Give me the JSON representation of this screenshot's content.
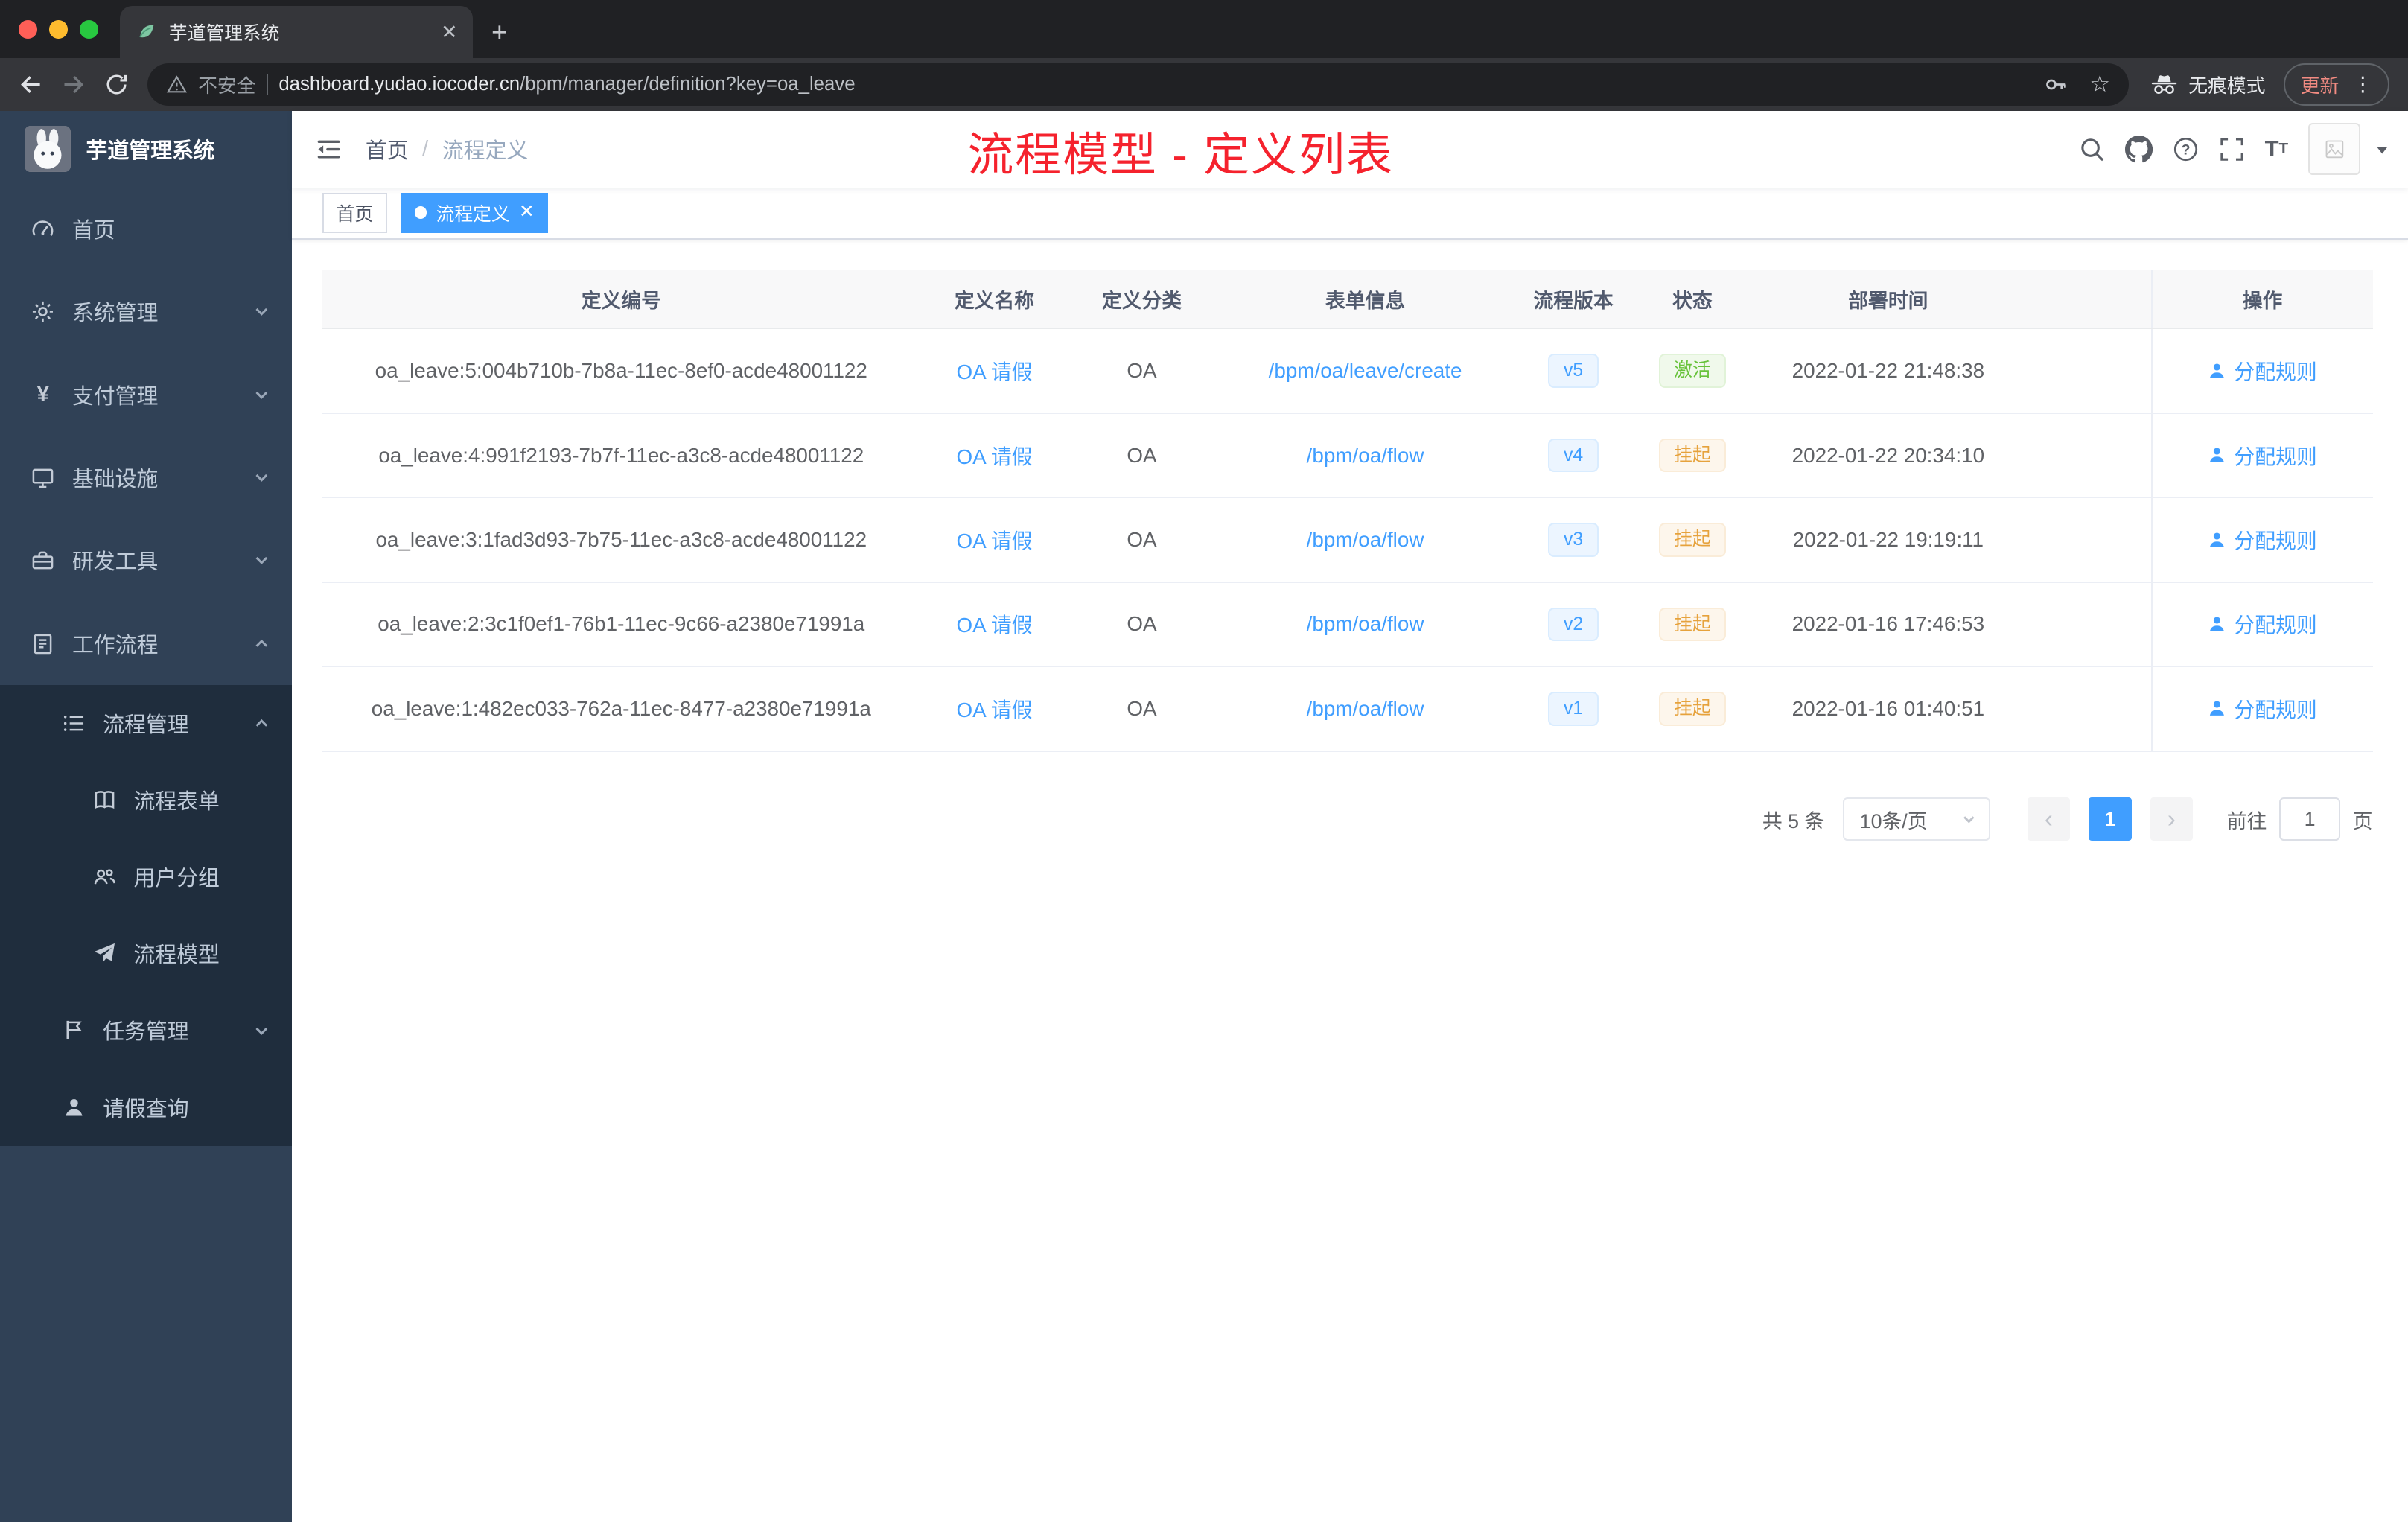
{
  "browser": {
    "tab_title": "芋道管理系统",
    "security_label": "不安全",
    "url_domain": "dashboard.yudao.iocoder.cn",
    "url_path": "/bpm/manager/definition?key=oa_leave",
    "incognito_label": "无痕模式",
    "update_label": "更新"
  },
  "sidebar": {
    "logo_title": "芋道管理系统",
    "items": [
      {
        "label": "首页"
      },
      {
        "label": "系统管理"
      },
      {
        "label": "支付管理"
      },
      {
        "label": "基础设施"
      },
      {
        "label": "研发工具"
      },
      {
        "label": "工作流程"
      },
      {
        "label": "流程管理"
      },
      {
        "label": "流程表单"
      },
      {
        "label": "用户分组"
      },
      {
        "label": "流程模型"
      },
      {
        "label": "任务管理"
      },
      {
        "label": "请假查询"
      }
    ]
  },
  "navbar": {
    "breadcrumb_home": "首页",
    "breadcrumb_separator": "/",
    "breadcrumb_current": "流程定义",
    "annotation": "流程模型 - 定义列表"
  },
  "tags": {
    "home": "首页",
    "active": "流程定义"
  },
  "table": {
    "columns": [
      "定义编号",
      "定义名称",
      "定义分类",
      "表单信息",
      "流程版本",
      "状态",
      "部署时间",
      "操作"
    ],
    "rows": [
      {
        "id": "oa_leave:5:004b710b-7b8a-11ec-8ef0-acde48001122",
        "name": "OA 请假",
        "category": "OA",
        "form": "/bpm/oa/leave/create",
        "version": "v5",
        "version_type": "info",
        "status": "激活",
        "status_type": "success",
        "deploy_time": "2022-01-22 21:48:38",
        "action": "分配规则"
      },
      {
        "id": "oa_leave:4:991f2193-7b7f-11ec-a3c8-acde48001122",
        "name": "OA 请假",
        "category": "OA",
        "form": "/bpm/oa/flow",
        "version": "v4",
        "version_type": "info",
        "status": "挂起",
        "status_type": "warning",
        "deploy_time": "2022-01-22 20:34:10",
        "action": "分配规则"
      },
      {
        "id": "oa_leave:3:1fad3d93-7b75-11ec-a3c8-acde48001122",
        "name": "OA 请假",
        "category": "OA",
        "form": "/bpm/oa/flow",
        "version": "v3",
        "version_type": "info",
        "status": "挂起",
        "status_type": "warning",
        "deploy_time": "2022-01-22 19:19:11",
        "action": "分配规则"
      },
      {
        "id": "oa_leave:2:3c1f0ef1-76b1-11ec-9c66-a2380e71991a",
        "name": "OA 请假",
        "category": "OA",
        "form": "/bpm/oa/flow",
        "version": "v2",
        "version_type": "info",
        "status": "挂起",
        "status_type": "warning",
        "deploy_time": "2022-01-16 17:46:53",
        "action": "分配规则"
      },
      {
        "id": "oa_leave:1:482ec033-762a-11ec-8477-a2380e71991a",
        "name": "OA 请假",
        "category": "OA",
        "form": "/bpm/oa/flow",
        "version": "v1",
        "version_type": "info",
        "status": "挂起",
        "status_type": "warning",
        "deploy_time": "2022-01-16 01:40:51",
        "action": "分配规则"
      }
    ]
  },
  "pagination": {
    "total": "共 5 条",
    "page_size": "10条/页",
    "prev": "‹",
    "current_page": "1",
    "next": "›",
    "goto_label": "前往",
    "goto_value": "1",
    "goto_unit": "页"
  },
  "colors": {
    "primary": "#409eff",
    "success": "#67c23a",
    "warning": "#e6a23c",
    "annotation_red": "#f5222d"
  }
}
